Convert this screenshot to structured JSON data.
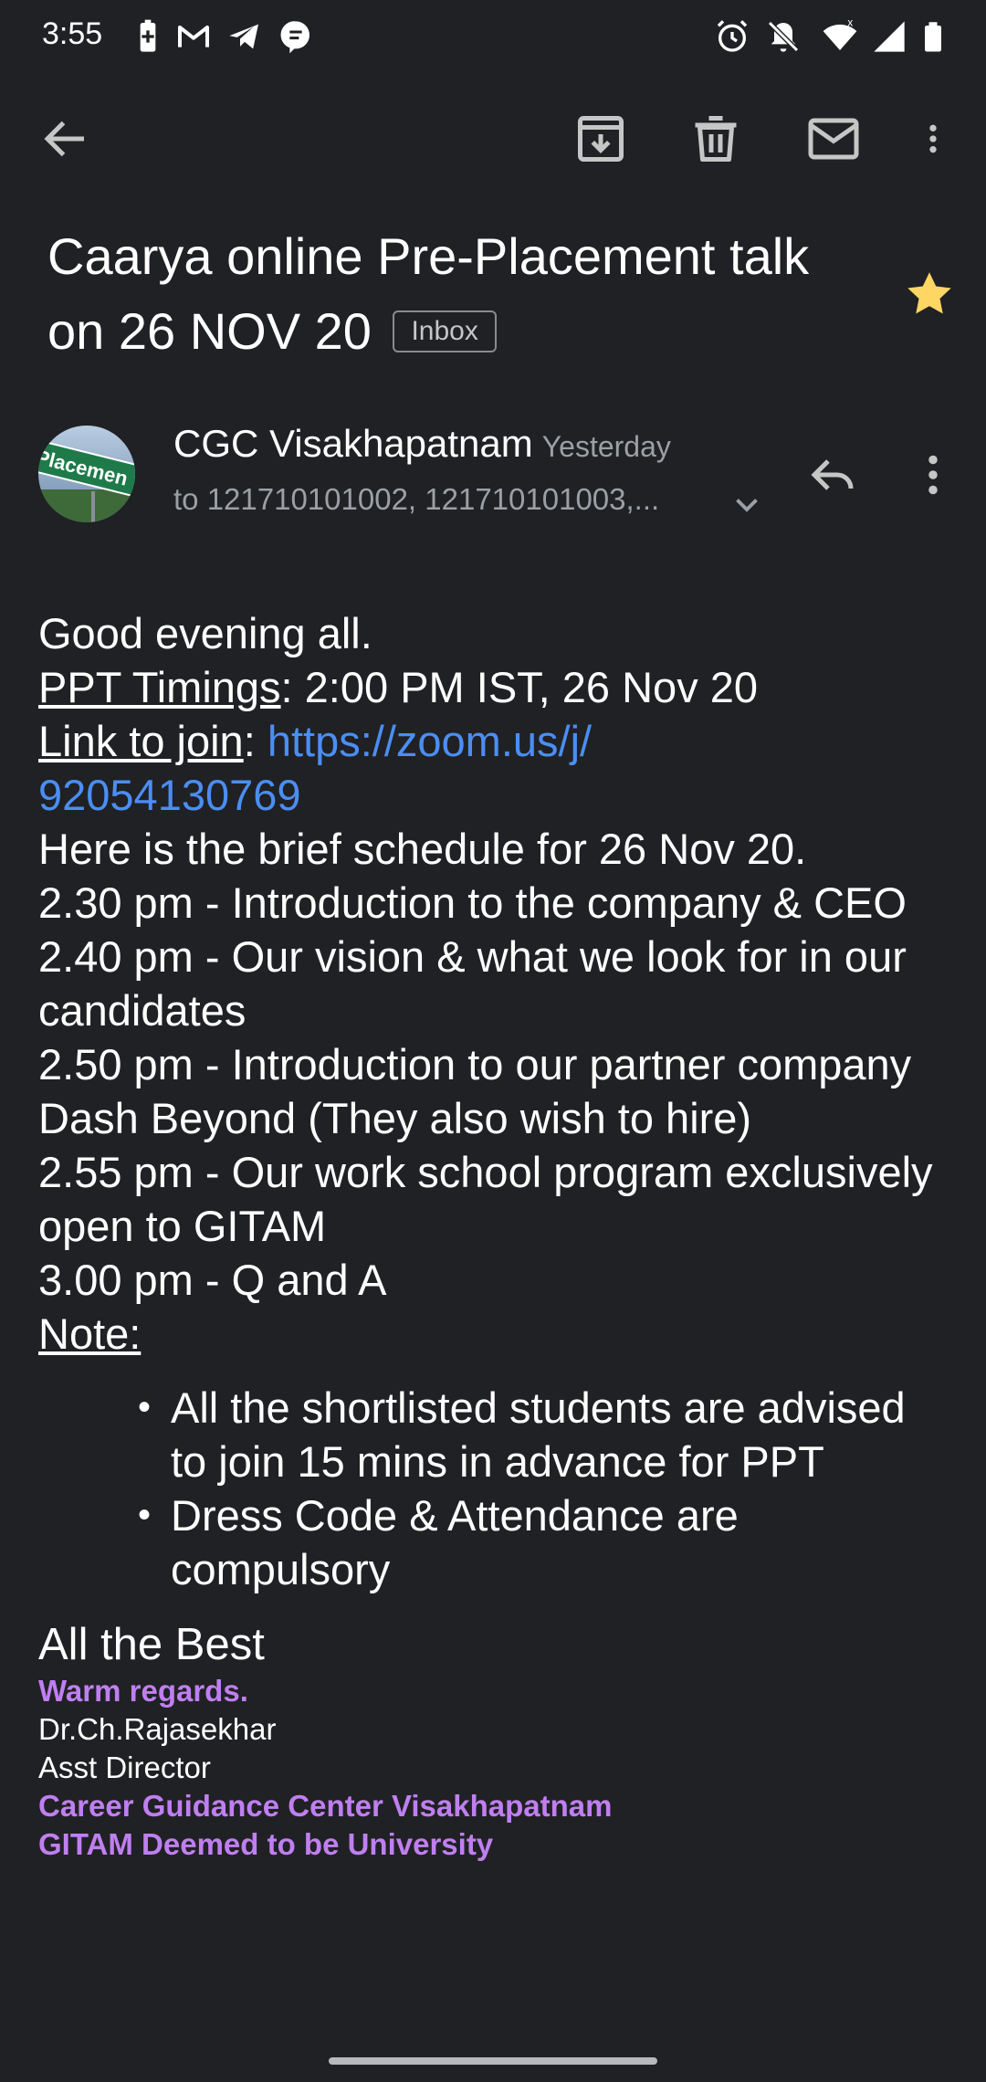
{
  "status_bar": {
    "time": "3:55",
    "left_icons": [
      "battery-saver-icon",
      "gmail-icon",
      "telegram-icon",
      "chat-bubble-icon"
    ],
    "right_icons": [
      "alarm-icon",
      "notifications-off-icon",
      "wifi-icon",
      "signal-icon",
      "battery-icon"
    ]
  },
  "toolbar": {
    "icons": [
      "back-arrow-icon",
      "archive-icon",
      "delete-icon",
      "mark-unread-icon",
      "more-vert-icon"
    ]
  },
  "subject": {
    "line1": "Caarya online Pre-Placement talk",
    "line2": "on 26 NOV 20",
    "label": "Inbox",
    "starred": true,
    "star_color": "#fdd663"
  },
  "sender": {
    "name": "CGC Visakhapatnam",
    "time": "Yesterday",
    "recipients": "to 121710101002, 121710101003,...",
    "avatar_text": "Placemen"
  },
  "body": {
    "greeting": "Good evening all.",
    "ppt_label": "PPT Timings",
    "ppt_value": ": 2:00 PM IST, 26 Nov 20",
    "link_label": "Link to join",
    "link_sep": ": ",
    "link_line1": "https://zoom.us/j/",
    "link_line2": "92054130769",
    "schedule_intro": "Here is the brief schedule for 26 Nov 20.",
    "schedule": [
      "2.30 pm - Introduction to the company & CEO",
      "2.40 pm - Our vision & what we look for in our candidates",
      "2.50 pm - Introduction to our partner company Dash Beyond (They also wish to hire)",
      "2.55 pm - Our work school program exclusively open to GITAM",
      "3.00 pm - Q and A"
    ],
    "note_label": "Note:",
    "notes": [
      "All the shortlisted students are advised to join 15 mins in advance for PPT",
      "Dress Code & Attendance are compulsory"
    ],
    "closing": "All the Best"
  },
  "signature": {
    "regards": "Warm regards",
    "regards_punct": ".",
    "name": "Dr.Ch.Rajasekhar",
    "title": "Asst Director",
    "org": "Career Guidance Center Visakhapatnam",
    "university": "GITAM Deemed to be University"
  },
  "colors": {
    "background": "#202124",
    "link": "#4b8ef4",
    "signature_accent": "#c07ff0",
    "muted_text": "#9aa0a6"
  }
}
